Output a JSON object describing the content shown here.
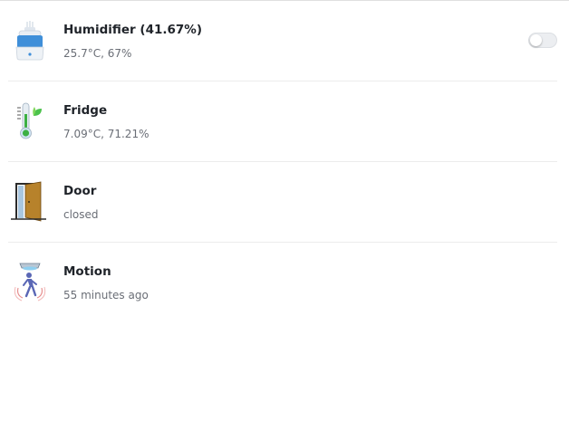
{
  "devices": [
    {
      "name": "Humidifier (41.67%)",
      "status": "25.7°C, 67%",
      "icon": "humidifier-icon",
      "toggle": {
        "on": false
      }
    },
    {
      "name": "Fridge",
      "status": "7.09°C, 71.21%",
      "icon": "thermometer-plant-icon"
    },
    {
      "name": "Door",
      "status": "closed",
      "icon": "door-icon"
    },
    {
      "name": "Motion",
      "status": "55 minutes ago",
      "icon": "motion-sensor-icon"
    }
  ],
  "colors": {
    "toggle_off": "#eceef1",
    "text_primary": "#1f2329",
    "text_secondary": "#6a6e76"
  }
}
